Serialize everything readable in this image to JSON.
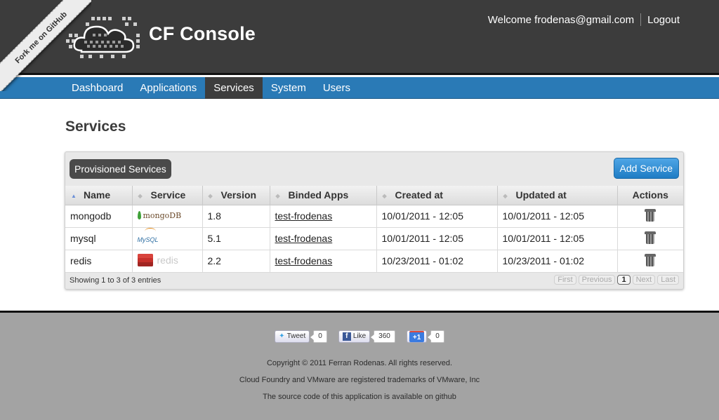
{
  "ribbon": {
    "label": "Fork me on GitHub"
  },
  "header": {
    "brand": "CF Console",
    "welcome": "Welcome frodenas@gmail.com",
    "logout": "Logout"
  },
  "nav": {
    "items": [
      {
        "label": "Dashboard",
        "active": false
      },
      {
        "label": "Applications",
        "active": false
      },
      {
        "label": "Services",
        "active": true
      },
      {
        "label": "System",
        "active": false
      },
      {
        "label": "Users",
        "active": false
      }
    ]
  },
  "main": {
    "title": "Services",
    "panel_title": "Provisioned Services",
    "add_button": "Add Service",
    "columns": [
      "Name",
      "Service",
      "Version",
      "Binded Apps",
      "Created at",
      "Updated at",
      "Actions"
    ],
    "rows": [
      {
        "name": "mongodb",
        "service_logo": "mongodb-logo",
        "service_text": "mongoDB",
        "version": "1.8",
        "binded_app": "test-frodenas",
        "created": "10/01/2011 - 12:05",
        "updated": "10/01/2011 - 12:05",
        "action_icon": "trash-icon"
      },
      {
        "name": "mysql",
        "service_logo": "mysql-logo",
        "service_text": "MySQL",
        "version": "5.1",
        "binded_app": "test-frodenas",
        "created": "10/01/2011 - 12:05",
        "updated": "10/01/2011 - 12:05",
        "action_icon": "trash-icon"
      },
      {
        "name": "redis",
        "service_logo": "redis-logo",
        "service_text": "redis",
        "version": "2.2",
        "binded_app": "test-frodenas",
        "created": "10/23/2011 - 01:02",
        "updated": "10/23/2011 - 01:02",
        "action_icon": "trash-icon"
      }
    ],
    "info": "Showing 1 to 3 of 3 entries",
    "pager": {
      "first": "First",
      "previous": "Previous",
      "current": "1",
      "next": "Next",
      "last": "Last"
    }
  },
  "footer": {
    "tweet_label": "Tweet",
    "tweet_count": "0",
    "like_label": "Like",
    "like_count": "360",
    "plusone_label": "+1",
    "plusone_count": "0",
    "copyright": "Copyright © 2011 Ferran Rodenas. All rights reserved.",
    "trademark": "Cloud Foundry and VMware are registered trademarks of VMware, Inc",
    "source": "The source code of this application is available on github"
  },
  "colors": {
    "header_bg": "#3c3c3c",
    "nav_bg": "#2a7ab6",
    "nav_active_bg": "#3d3d3d",
    "button_blue": "#1f7cc4",
    "footer_bg": "#a3a3a3"
  }
}
